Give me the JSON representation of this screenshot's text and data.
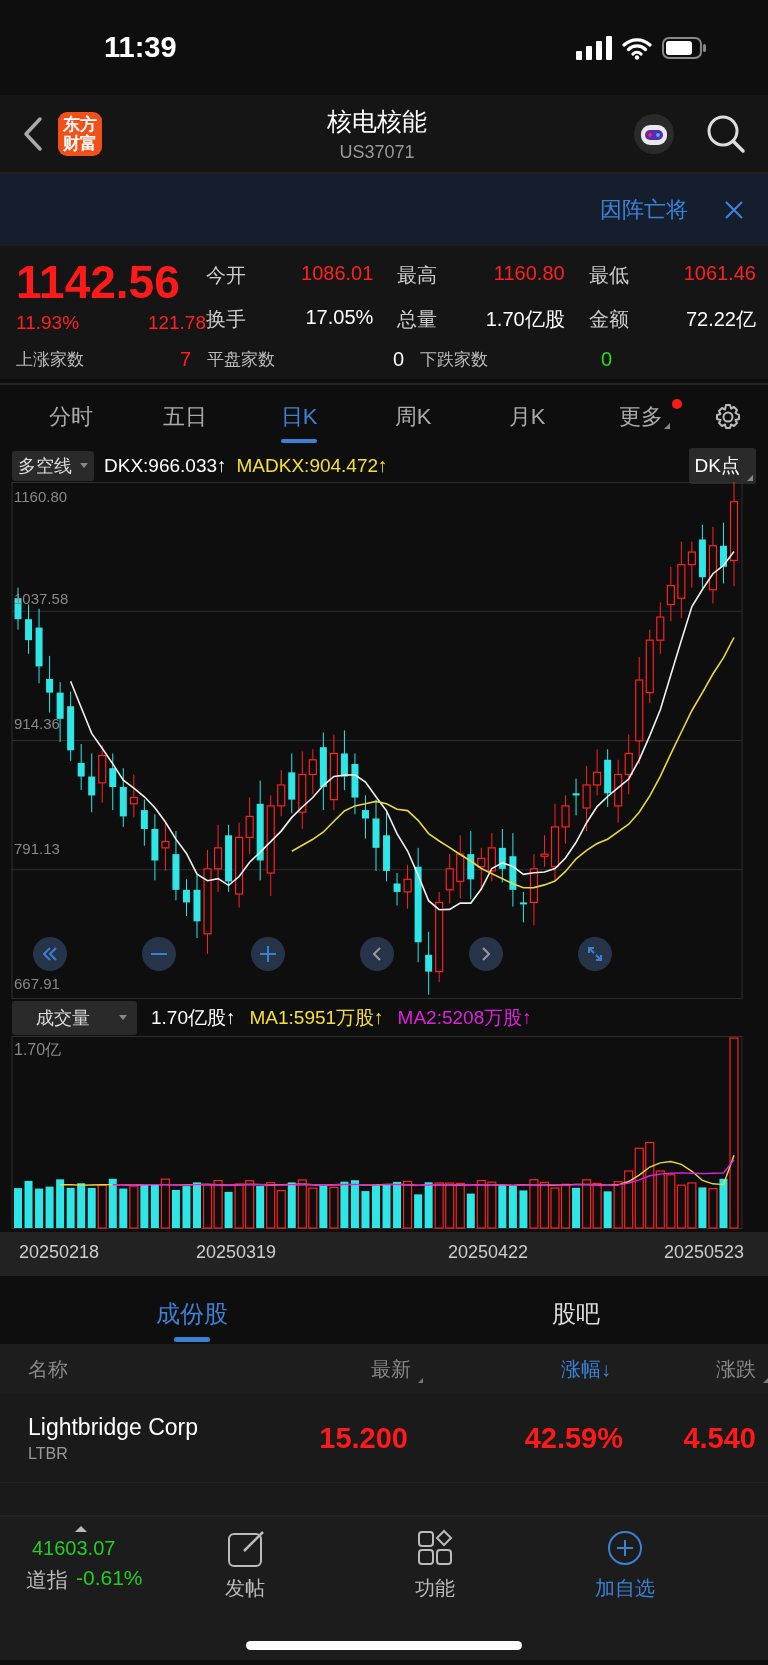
{
  "status_bar": {
    "time": "11:39"
  },
  "header": {
    "logo_text": "东方财富",
    "title": "核电核能",
    "code": "US37071"
  },
  "banner": {
    "text": "因阵亡将"
  },
  "quote": {
    "price": "1142.56",
    "change_pct": "11.93%",
    "change": "121.78",
    "stats": [
      {
        "label": "今开",
        "value": "1086.01",
        "color": "#ff2020"
      },
      {
        "label": "最高",
        "value": "1160.80",
        "color": "#ff2020"
      },
      {
        "label": "最低",
        "value": "1061.46",
        "color": "#ff2020"
      },
      {
        "label": "换手",
        "value": "17.05%",
        "color": "#ffffff"
      },
      {
        "label": "总量",
        "value": "1.70亿股",
        "color": "#ffffff"
      },
      {
        "label": "金额",
        "value": "72.22亿",
        "color": "#ffffff"
      }
    ],
    "breadth": [
      {
        "label": "上涨家数",
        "value": "7",
        "color": "#ff2020"
      },
      {
        "label": "平盘家数",
        "value": "0",
        "color": "#ffffff"
      },
      {
        "label": "下跌家数",
        "value": "0",
        "color": "#22dd22"
      }
    ]
  },
  "period_tabs": [
    {
      "label": "分时",
      "selected": false,
      "dot": false,
      "dropdown": false
    },
    {
      "label": "五日",
      "selected": false,
      "dot": false,
      "dropdown": false
    },
    {
      "label": "日K",
      "selected": true,
      "dot": false,
      "dropdown": false
    },
    {
      "label": "周K",
      "selected": false,
      "dot": false,
      "dropdown": false
    },
    {
      "label": "月K",
      "selected": false,
      "dot": false,
      "dropdown": false
    },
    {
      "label": "更多",
      "selected": false,
      "dot": true,
      "dropdown": true
    }
  ],
  "indicator": {
    "selector": "多空线",
    "readings": [
      {
        "text": "DKX:966.033↑",
        "color": "#ffffff"
      },
      {
        "text": "MADKX:904.472↑",
        "color": "#f5e133"
      }
    ],
    "button": "DK点"
  },
  "kline": {
    "y_labels": [
      "1160.80",
      "1037.58",
      "914.36",
      "791.13",
      "667.91"
    ]
  },
  "volume": {
    "selector": "成交量",
    "readings": [
      {
        "text": "1.70亿股↑",
        "color": "#ffffff"
      },
      {
        "text": "MA1:5951万股↑",
        "color": "#f5e133"
      },
      {
        "text": "MA2:5208万股↑",
        "color": "#e020e0"
      }
    ],
    "y_label": "1.70亿",
    "dates": [
      "20250218",
      "20250319",
      "20250422",
      "20250523"
    ]
  },
  "sub_tabs": [
    {
      "label": "成份股",
      "selected": true
    },
    {
      "label": "股吧",
      "selected": false
    }
  ],
  "table": {
    "columns": [
      {
        "label": "名称",
        "sortable": false,
        "sorted": false
      },
      {
        "label": "最新",
        "sortable": true,
        "sorted": false
      },
      {
        "label": "涨幅↓",
        "sortable": false,
        "sorted": true
      },
      {
        "label": "涨跌",
        "sortable": true,
        "sorted": false
      }
    ],
    "rows": [
      {
        "name": "Lightbridge Corp",
        "code": "LTBR",
        "price": "15.200",
        "change_pct": "42.59%",
        "change": "4.540"
      }
    ]
  },
  "index_ticker": {
    "value": "41603.07",
    "name": "道指",
    "change_pct": "-0.61%"
  },
  "actions": [
    {
      "label": "发帖",
      "kind": "post",
      "highlighted": false
    },
    {
      "label": "功能",
      "kind": "functions",
      "highlighted": false
    },
    {
      "label": "加自选",
      "kind": "add",
      "highlighted": true
    }
  ]
}
